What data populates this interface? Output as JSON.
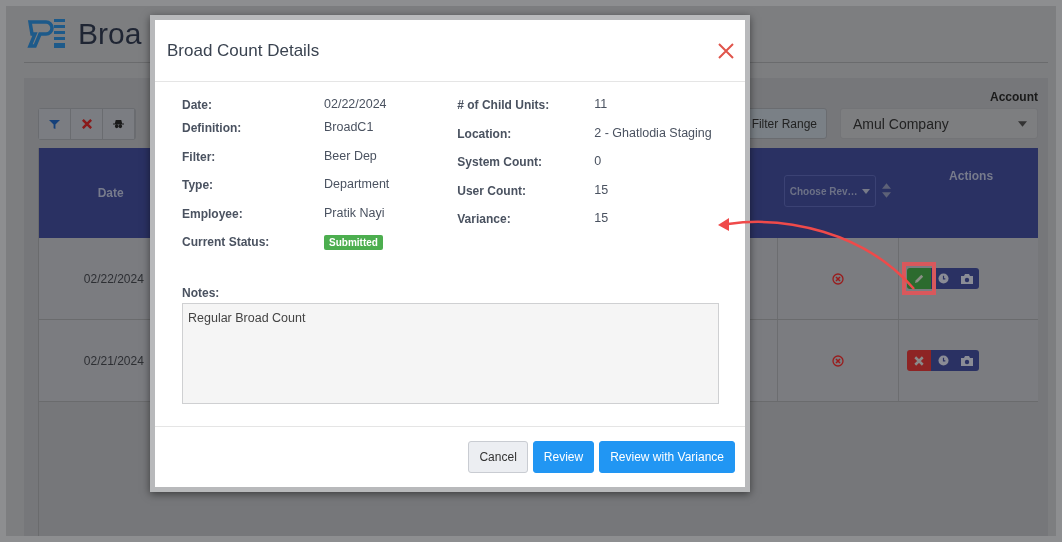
{
  "page": {
    "title": "Broa",
    "filter_button": "Filter Range",
    "account": {
      "label": "Account",
      "value": "Amul Company"
    },
    "table": {
      "columns": [
        {
          "label": "Date",
          "kind": "plain"
        },
        {
          "label": "Choose Rev…",
          "kind": "dropdown"
        },
        {
          "label": "Actions",
          "kind": "plain"
        }
      ],
      "rows": [
        {
          "date": "02/22/2024",
          "actions": [
            {
              "kind": "edit"
            },
            {
              "kind": "history"
            },
            {
              "kind": "photo"
            }
          ]
        },
        {
          "date": "02/21/2024",
          "actions": [
            {
              "kind": "delete"
            },
            {
              "kind": "history"
            },
            {
              "kind": "photo"
            }
          ]
        }
      ]
    }
  },
  "modal": {
    "title": "Broad Count Details",
    "left": [
      {
        "label": "Date:",
        "value": "02/22/2024",
        "kind": "text"
      },
      {
        "label": "Definition:",
        "value": "BroadC1",
        "kind": "text"
      },
      {
        "label": "Filter:",
        "value": "Beer Dep",
        "kind": "text"
      },
      {
        "label": "Type:",
        "value": "Department",
        "kind": "text"
      },
      {
        "label": "Employee:",
        "value": "Pratik Nayi",
        "kind": "text"
      },
      {
        "label": "Current Status:",
        "value": "Submitted",
        "kind": "badge"
      }
    ],
    "right": [
      {
        "label": "# of Child Units:",
        "value": "11",
        "kind": "text"
      },
      {
        "label": "Location:",
        "value": "2 - Ghatlodia Staging",
        "kind": "text"
      },
      {
        "label": "System Count:",
        "value": "0",
        "kind": "text"
      },
      {
        "label": "User Count:",
        "value": "15",
        "kind": "text"
      },
      {
        "label": "Variance:",
        "value": "15",
        "kind": "text"
      }
    ],
    "notes": {
      "label": "Notes:",
      "value": "Regular Broad Count"
    },
    "buttons": [
      {
        "label": "Cancel",
        "kind": "secondary"
      },
      {
        "label": "Review",
        "kind": "primary"
      },
      {
        "label": "Review with Variance",
        "kind": "primary"
      }
    ]
  }
}
